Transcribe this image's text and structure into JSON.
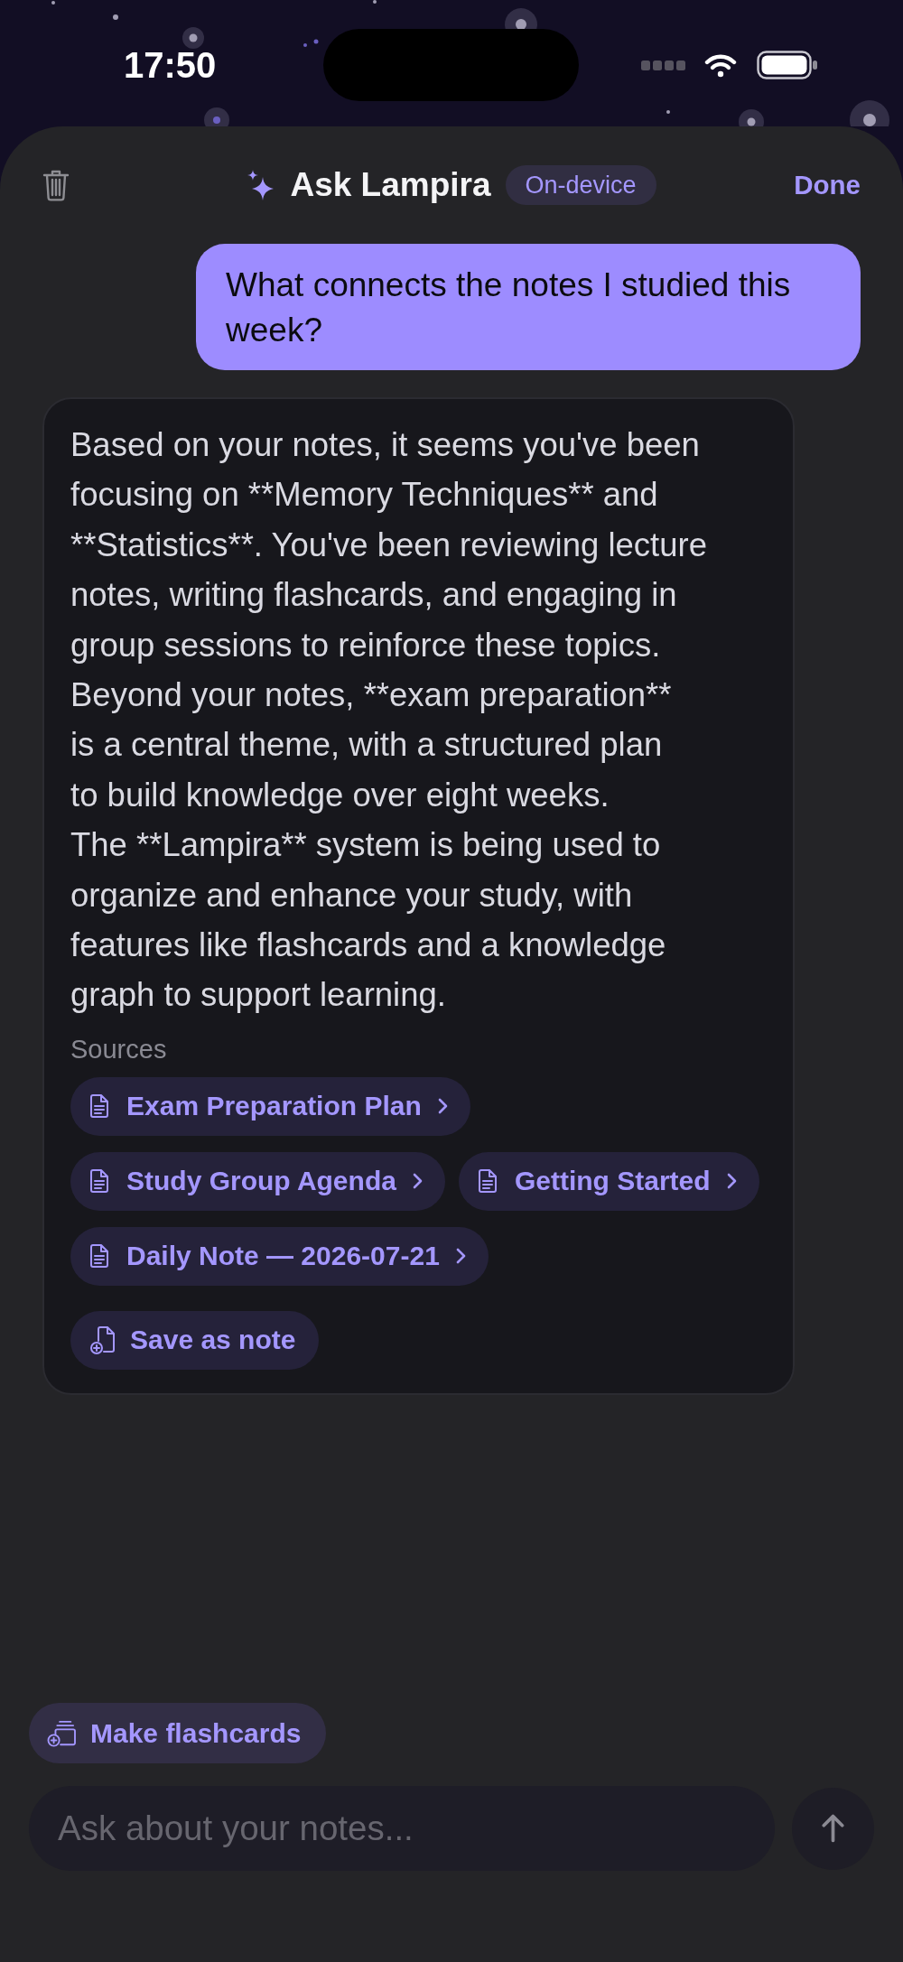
{
  "status_bar": {
    "time": "17:50"
  },
  "header": {
    "title": "Ask Lampira",
    "badge": "On-device",
    "done": "Done"
  },
  "messages": [
    {
      "kind": "user",
      "text": "What connects the notes I studied this week?"
    },
    {
      "kind": "assistant",
      "text": "Based on your notes, it seems you've been\nfocusing on **Memory Techniques** and\n**Statistics**. You've been reviewing lecture\nnotes, writing flashcards, and engaging in\ngroup sessions to reinforce these topics.\nBeyond your notes, **exam preparation**\nis a central theme, with a structured plan\nto build knowledge over eight weeks.\nThe **Lampira** system is being used to\norganize and enhance your study, with\nfeatures like flashcards and a knowledge\ngraph to support learning.",
      "sources_label": "Sources",
      "sources": [
        {
          "title": "Exam Preparation Plan"
        },
        {
          "title": "Study Group Agenda"
        },
        {
          "title": "Getting Started"
        },
        {
          "title": "Daily Note — 2026-07-21"
        }
      ],
      "actions": [
        {
          "label": "Save as note"
        }
      ]
    }
  ],
  "suggestions": [
    {
      "label": "Make flashcards"
    }
  ],
  "composer": {
    "placeholder": "Ask about your notes...",
    "send_disabled": true
  }
}
